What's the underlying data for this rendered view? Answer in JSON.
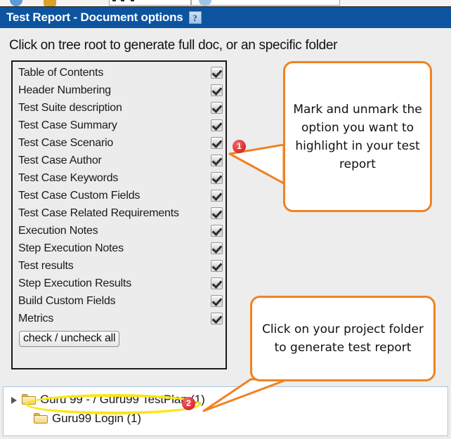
{
  "window": {
    "title": "Test Report - Document options",
    "help_icon_label": "?",
    "title_bar_color": "#0d54a0"
  },
  "instruction": "Click on tree root to generate full doc, or an specific folder",
  "options_panel": {
    "items": [
      {
        "label": "Table of Contents",
        "checked": true
      },
      {
        "label": "Header Numbering",
        "checked": true
      },
      {
        "label": "Test Suite description",
        "checked": true
      },
      {
        "label": "Test Case Summary",
        "checked": true
      },
      {
        "label": "Test Case Scenario",
        "checked": true
      },
      {
        "label": "Test Case Author",
        "checked": true
      },
      {
        "label": "Test Case Keywords",
        "checked": true
      },
      {
        "label": "Test Case Custom Fields",
        "checked": true
      },
      {
        "label": "Test Case Related Requirements",
        "checked": true
      },
      {
        "label": "Execution Notes",
        "checked": true
      },
      {
        "label": "Step Execution Notes",
        "checked": true
      },
      {
        "label": "Test results",
        "checked": true
      },
      {
        "label": "Step Execution Results",
        "checked": true
      },
      {
        "label": "Build Custom Fields",
        "checked": true
      },
      {
        "label": "Metrics",
        "checked": true
      }
    ],
    "toggle_all_label": "check / uncheck all"
  },
  "callouts": [
    {
      "id": "callout-1",
      "text": "Mark and unmark the option you want to highlight in your test report",
      "border_color": "#f08222"
    },
    {
      "id": "callout-2",
      "text": "Click on your project folder to generate test report",
      "border_color": "#f08222"
    }
  ],
  "badges": [
    {
      "id": "badge-1",
      "label": "1",
      "color": "#d82b2b"
    },
    {
      "id": "badge-2",
      "label": "2",
      "color": "#d82b2b"
    }
  ],
  "tree": {
    "root": {
      "label": "Guru 99 - / Guru99 TestPlan (1)"
    },
    "child": {
      "label": "Guru99 Login (1)"
    },
    "highlight_color": "#fbe617"
  }
}
